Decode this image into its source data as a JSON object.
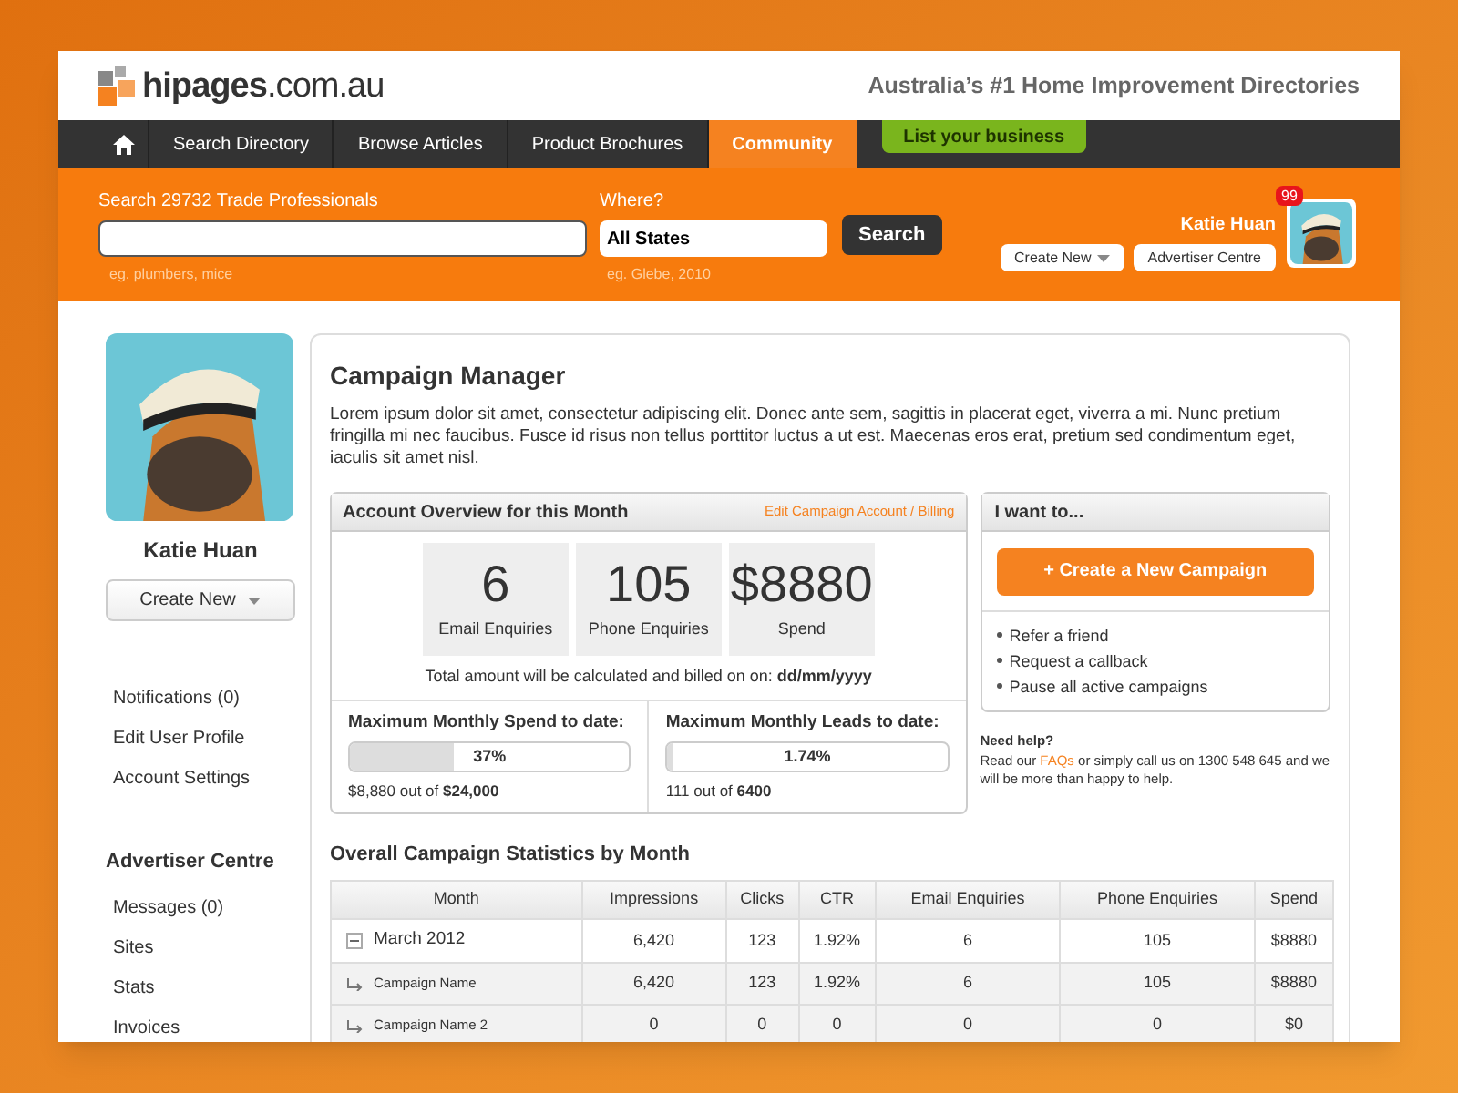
{
  "header": {
    "logo": "hipages",
    "logo_suffix": ".com.au",
    "tagline": "Australia’s #1 Home Improvement Directories"
  },
  "nav": {
    "items": [
      {
        "label": "Search Directory",
        "selected": false
      },
      {
        "label": "Browse Articles",
        "selected": false
      },
      {
        "label": "Product Brochures",
        "selected": false
      },
      {
        "label": "Community",
        "selected": true
      }
    ],
    "cta": "List your business"
  },
  "search": {
    "label": "Search 29732 Trade Professionals",
    "hint": "eg. plumbers, mice",
    "where_label": "Where?",
    "where_value": "All States",
    "where_hint": "eg. Glebe, 2010",
    "button": "Search"
  },
  "user": {
    "name": "Katie Huan",
    "badge": "99",
    "create_new": "Create New",
    "advertiser_centre": "Advertiser Centre"
  },
  "sidebar": {
    "name": "Katie Huan",
    "create_new": "Create New",
    "links": [
      "Notifications (0)",
      "Edit User Profile",
      "Account Settings"
    ],
    "section_title": "Advertiser Centre",
    "section_links": [
      "Messages (0)",
      "Sites",
      "Stats",
      "Invoices"
    ]
  },
  "campaign": {
    "title": "Campaign Manager",
    "intro": "Lorem ipsum dolor sit amet, consectetur adipiscing elit. Donec ante sem, sagittis in placerat eget, viverra a mi. Nunc pretium fringilla mi nec faucibus. Fusce id risus non tellus porttitor luctus a ut est. Maecenas eros erat, pretium sed condimentum eget, iaculis sit amet nisl."
  },
  "overview": {
    "title": "Account Overview for this Month",
    "edit_link": "Edit Campaign Account / Billing",
    "stats": [
      {
        "value": "6",
        "label": "Email Enquiries"
      },
      {
        "value": "105",
        "label": "Phone Enquiries"
      },
      {
        "value": "$8880",
        "label": "Spend"
      }
    ],
    "billing_note": "Total amount will be calculated and billed on on: **dd/mm/yyyy**",
    "meters": [
      {
        "title": "Maximum Monthly Spend to date:",
        "level": 0.37,
        "reading": "37%",
        "caption": "$8,880 out of **$24,000**"
      },
      {
        "title": "Maximum Monthly Leads to date:",
        "level": 0.0174,
        "reading": "1.74%",
        "caption": "111 out of **6400**"
      }
    ]
  },
  "actions": {
    "title": "I want to...",
    "button": "+ Create a New Campaign",
    "links": [
      "Refer a friend",
      "Request a callback",
      "Pause all active campaigns"
    ],
    "help_title": "Need help?",
    "help_before": "Read our",
    "help_link": "FAQs",
    "help_after": "or simply call us on 1300 548 645 and we will be more than happy to help."
  },
  "stats_table": {
    "title": "Overall Campaign Statistics by Month",
    "columns": [
      "Month",
      "Impressions",
      "Clicks",
      "CTR",
      "Email Enquiries",
      "Phone Enquiries",
      "Spend"
    ],
    "rows": [
      {
        "kind": "month",
        "expanded": true,
        "cells": [
          "March 2012",
          "6,420",
          "123",
          "1.92%",
          "6",
          "105",
          "$8880"
        ]
      },
      {
        "kind": "campaign",
        "cells": [
          "Campaign Name",
          "6,420",
          "123",
          "1.92%",
          "6",
          "105",
          "$8880"
        ]
      },
      {
        "kind": "campaign",
        "cells": [
          "Campaign Name 2",
          "0",
          "0",
          "0",
          "0",
          "0",
          "$0"
        ]
      }
    ]
  }
}
